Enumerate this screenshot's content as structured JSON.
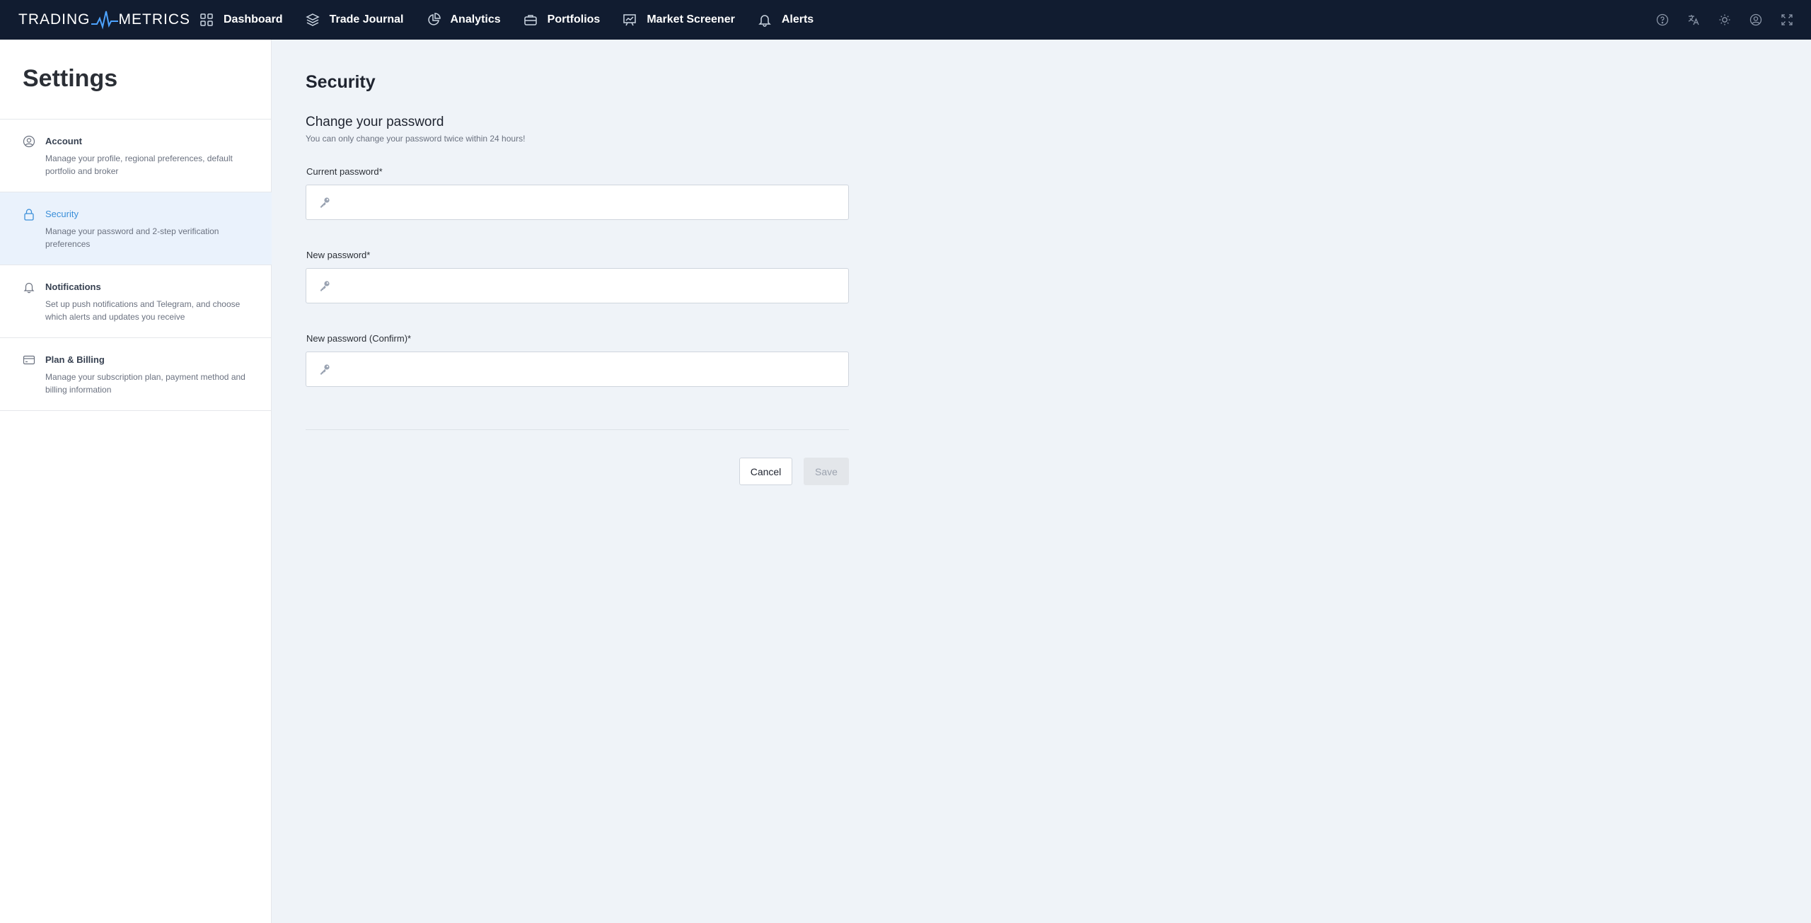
{
  "brand": {
    "left": "TRADING",
    "right": "METRICS"
  },
  "nav": {
    "items": [
      {
        "label": "Dashboard",
        "icon": "grid-icon"
      },
      {
        "label": "Trade Journal",
        "icon": "layers-icon"
      },
      {
        "label": "Analytics",
        "icon": "pie-chart-icon"
      },
      {
        "label": "Portfolios",
        "icon": "briefcase-icon"
      },
      {
        "label": "Market Screener",
        "icon": "presentation-chart-icon"
      },
      {
        "label": "Alerts",
        "icon": "bell-icon"
      }
    ],
    "right_icons": [
      "help-icon",
      "translate-icon",
      "sun-icon",
      "user-circle-icon",
      "fullscreen-icon"
    ]
  },
  "sidebar": {
    "title": "Settings",
    "items": [
      {
        "label": "Account",
        "description": "Manage your profile, regional preferences, default portfolio and broker",
        "icon": "user-circle-icon",
        "active": false
      },
      {
        "label": "Security",
        "description": "Manage your password and 2-step verification preferences",
        "icon": "lock-icon",
        "active": true
      },
      {
        "label": "Notifications",
        "description": "Set up push notifications and Telegram, and choose which alerts and updates you receive",
        "icon": "bell-icon",
        "active": false
      },
      {
        "label": "Plan & Billing",
        "description": "Manage your subscription plan, payment method and billing information",
        "icon": "credit-card-icon",
        "active": false
      }
    ]
  },
  "main": {
    "title": "Security",
    "section_title": "Change your password",
    "section_subtitle": "You can only change your password twice within 24 hours!",
    "fields": {
      "current": {
        "label": "Current password",
        "required_mark": "*",
        "value": ""
      },
      "new": {
        "label": "New password",
        "required_mark": "*",
        "value": ""
      },
      "confirm": {
        "label": "New password (Confirm)",
        "required_mark": "*",
        "value": ""
      }
    },
    "buttons": {
      "cancel": "Cancel",
      "save": "Save"
    }
  },
  "colors": {
    "topbar": "#111c30",
    "accent": "#3b8fd9",
    "active_bg": "#eaf2fc",
    "page_bg": "#eff3f8"
  }
}
